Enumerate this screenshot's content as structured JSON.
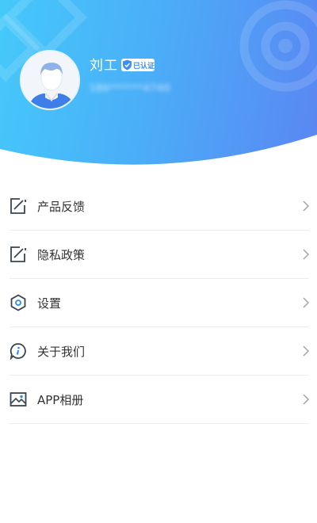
{
  "profile": {
    "name": "刘工",
    "verified_label": "已认证",
    "phone_masked": "186******4740"
  },
  "menu": [
    {
      "id": "feedback",
      "label": "产品反馈",
      "icon": "edit-note-icon"
    },
    {
      "id": "privacy",
      "label": "隐私政策",
      "icon": "edit-note-icon"
    },
    {
      "id": "settings",
      "label": "设置",
      "icon": "hexagon-settings-icon"
    },
    {
      "id": "about",
      "label": "关于我们",
      "icon": "info-chat-icon"
    },
    {
      "id": "album",
      "label": "APP相册",
      "icon": "image-icon"
    }
  ],
  "colors": {
    "header_start": "#45c9fa",
    "header_end": "#5a86f2",
    "icon": "#3a4550",
    "text": "#333333",
    "chevron": "#a0a4aa",
    "divider": "#ececec"
  }
}
